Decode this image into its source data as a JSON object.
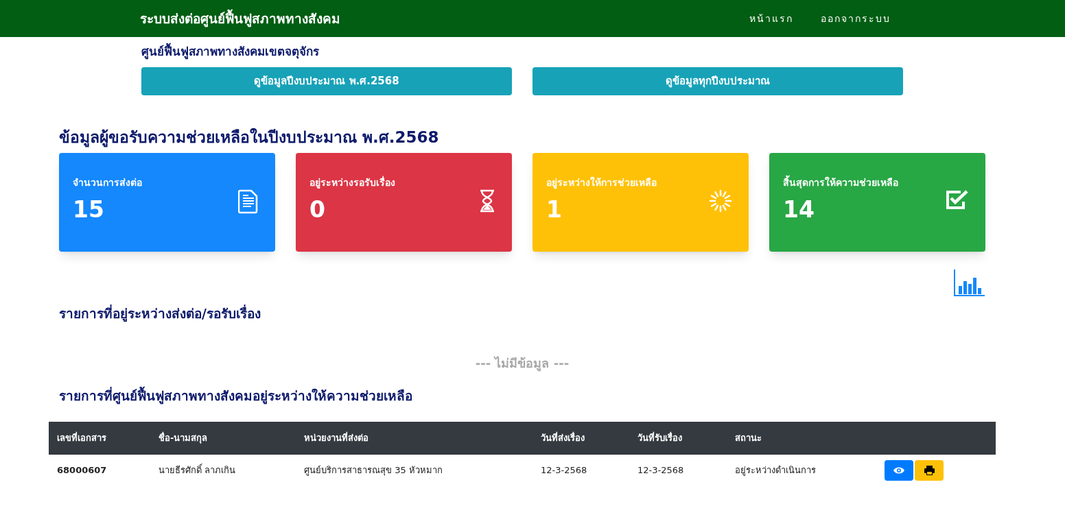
{
  "navbar": {
    "title": "ระบบส่งต่อศูนย์ฟื้นฟูสภาพทางสังคม",
    "links": [
      "หน้าแรก",
      "ออกจากระบบ"
    ]
  },
  "center_name": "ศูนย์ฟื้นฟูสภาพทางสังคมเขตจตุจักร",
  "top_buttons": [
    "ดูข้อมูลปีงบประมาณ พ.ศ.2568",
    "ดูข้อมูลทุกปีงบประมาณ"
  ],
  "summary_title": "ข้อมูลผู้ขอรับความช่วยเหลือในปีงบประมาณ พ.ศ.2568",
  "cards": [
    {
      "kind": "document",
      "label": "จำนวนการส่งต่อ",
      "value": "15",
      "color": "#1488fc"
    },
    {
      "kind": "hourglass",
      "label": "อยู่ระหว่างรอรับเรื่อง",
      "value": "0",
      "color": "#dc3545"
    },
    {
      "kind": "spinner",
      "label": "อยู่ระหว่างให้การช่วยเหลือ",
      "value": "1",
      "color": "#ffc107"
    },
    {
      "kind": "checkbox",
      "label": "สิ้นสุดการให้ความช่วยเหลือ",
      "value": "14",
      "color": "#28a745"
    }
  ],
  "pending_section": {
    "title": "รายการที่อยู่ระหว่างส่งต่อ/รอรับเรื่อง",
    "empty_text": "--- ไม่มีข้อมูล ---"
  },
  "assisting_section": {
    "title": "รายการที่ศูนย์ฟื้นฟูสภาพทางสังคมอยู่ระหว่างให้ความช่วยเหลือ",
    "table": {
      "columns": [
        "เลขที่เอกสาร",
        "ชื่อ-นามสกุล",
        "หน่วยงานที่ส่งต่อ",
        "วันที่ส่งเรื่อง",
        "วันที่รับเรื่อง",
        "สถานะ"
      ],
      "rows": [
        {
          "cells": [
            "68000607",
            "นายธีรศักดิ์ ลาภเกิน",
            "ศูนย์บริการสาธารณสุข 35 หัวหมาก",
            "12-3-2568",
            "12-3-2568",
            "อยู่ระหว่างดำเนินการ"
          ],
          "actions": [
            {
              "kind": "view",
              "color": "#007bff"
            },
            {
              "kind": "print",
              "color": "#ffc107"
            }
          ]
        }
      ]
    }
  }
}
